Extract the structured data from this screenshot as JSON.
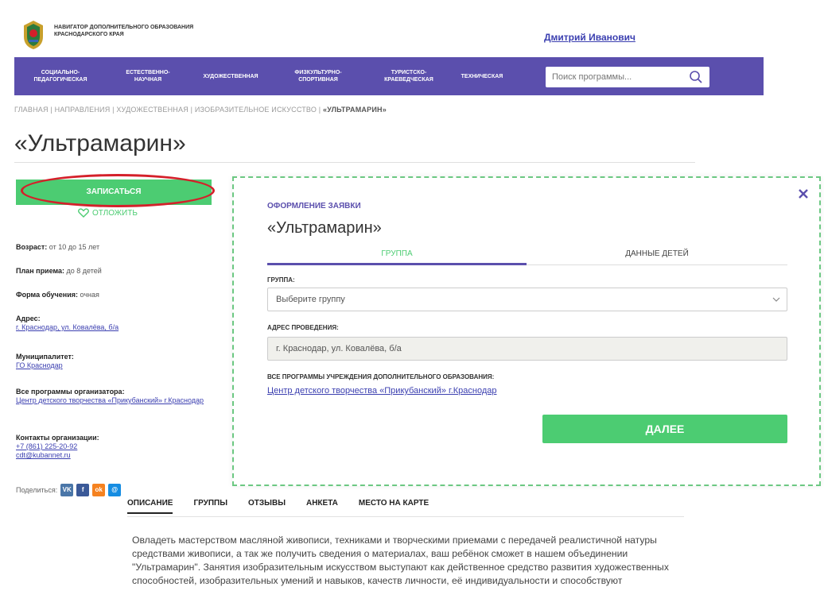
{
  "header": {
    "logo_text": "НАВИГАТОР ДОПОЛНИТЕЛЬНОГО ОБРАЗОВАНИЯ КРАСНОДАРСКОГО КРАЯ",
    "user_name": "Дмитрий Иванович"
  },
  "nav": {
    "items": [
      {
        "label": "СОЦИАЛЬНО-ПЕДАГОГИЧЕСКАЯ"
      },
      {
        "label": "ЕСТЕСТВЕННО-НАУЧНАЯ"
      },
      {
        "label": "ХУДОЖЕСТВЕННАЯ"
      },
      {
        "label": "ФИЗКУЛЬТУРНО-СПОРТИВНАЯ"
      },
      {
        "label": "ТУРИСТСКО-КРАЕВЕДЧЕСКАЯ"
      },
      {
        "label": "ТЕХНИЧЕСКАЯ"
      }
    ],
    "search_placeholder": "Поиск программы..."
  },
  "breadcrumb": {
    "items": [
      "ГЛАВНАЯ",
      "НАПРАВЛЕНИЯ",
      "ХУДОЖЕСТВЕННАЯ",
      "ИЗОБРАЗИТЕЛЬНОЕ ИСКУССТВО"
    ],
    "current": "«УЛЬТРАМАРИН»",
    "separator": "|"
  },
  "page": {
    "title": "«Ультрамарин»"
  },
  "left": {
    "enroll_label": "ЗАПИСАТЬСЯ",
    "postpone_label": "ОТЛОЖИТЬ",
    "age_label": "Возраст:",
    "age_value": "от 10 до 15 лет",
    "plan_label": "План приема:",
    "plan_value": "до 8 детей",
    "form_label": "Форма обучения:",
    "form_value": "очная",
    "address_label": "Адрес:",
    "address_value": "г. Краснодар, ул. Ковалёва, б/а",
    "municipality_label": "Муниципалитет:",
    "municipality_value": "ГО Краснодар",
    "programs_label": "Все программы организатора:",
    "programs_value": "Центр детского творчества «Прикубанский» г.Краснодар",
    "contacts_label": "Контакты организации:",
    "phone": "+7 (861) 225-20-92",
    "email": "cdt@kubannet.ru",
    "share_label": "Поделиться:",
    "social": [
      {
        "label": "VK",
        "color": "#4a76a8"
      },
      {
        "label": "f",
        "color": "#3b5998"
      },
      {
        "label": "ok",
        "color": "#f58220"
      },
      {
        "label": "@",
        "color": "#168de2"
      }
    ]
  },
  "tabs": {
    "items": [
      "ОПИСАНИЕ",
      "ГРУППЫ",
      "ОТЗЫВЫ",
      "АНКЕТА",
      "МЕСТО НА КАРТЕ"
    ]
  },
  "description": "Овладеть мастерством масляной живописи, техниками и творческими приемами с передачей реалистичной натуры средствами живописи, а так же получить сведения о материалах, ваш ребёнок сможет в нашем объединении \"Ультрамарин\".             Занятия изобразительным искусством выступают как действенное средство развития художественных способностей, изобразительных умений и навыков, качеств личности, её индивидуальности и способствуют",
  "modal": {
    "subtitle": "ОФОРМЛЕНИЕ ЗАЯВКИ",
    "title": "«Ультрамарин»",
    "tab_group": "ГРУППА",
    "tab_children": "ДАННЫЕ ДЕТЕЙ",
    "group_label": "ГРУППА:",
    "group_placeholder": "Выберите группу",
    "address_label": "АДРЕС ПРОВЕДЕНИЯ:",
    "address_value": "г. Краснодар, ул.  Ковалёва, б/а",
    "all_programs_label": "ВСЕ ПРОГРАММЫ УЧРЕЖДЕНИЯ ДОПОЛНИТЕЛЬНОГО ОБРАЗОВАНИЯ:",
    "all_programs_link": "Центр детского творчества «Прикубанский» г.Краснодар",
    "next_label": "ДАЛЕЕ"
  },
  "colors": {
    "nav_bg": "#5b4fad",
    "accent_green": "#4ccc72",
    "link": "#3b3fb0",
    "highlight_red": "#d4202a"
  }
}
